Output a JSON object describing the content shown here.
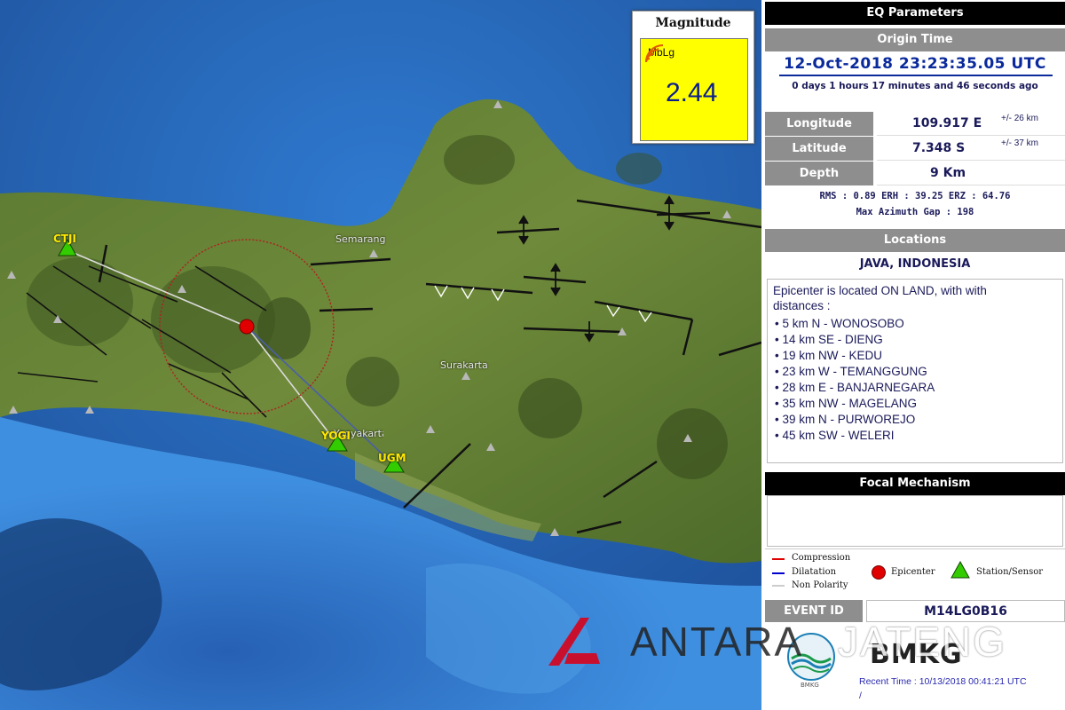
{
  "map": {
    "places": [
      "Semarang",
      "Surakarta",
      "Yogyakarta"
    ],
    "stations": [
      "CTJI",
      "YOGI",
      "UGM"
    ]
  },
  "magnitude": {
    "title": "Magnitude",
    "unit": "MbLg",
    "value": "2.44"
  },
  "eq": {
    "header": "EQ Parameters",
    "origin_header": "Origin Time",
    "origin_time": "12-Oct-2018 23:23:35.05 UTC",
    "elapsed": "0 days 1 hours 17 minutes and 46 seconds  ago",
    "params": [
      {
        "label": "Longitude",
        "value": "109.917 E",
        "err": "+/- 26 km"
      },
      {
        "label": "Latitude",
        "value": "7.348 S",
        "err": "+/- 37 km"
      },
      {
        "label": "Depth",
        "value": "9 Km",
        "err": ""
      }
    ],
    "rms_line": "RMS : 0.89  ERH : 39.25  ERZ : 64.76",
    "max_azimuth": "Max Azimuth Gap : 198"
  },
  "locations": {
    "header": "Locations",
    "region": "JAVA, INDONESIA",
    "intro": "Epicenter is located ON LAND, with with distances :",
    "items": [
      "5 km N - WONOSOBO",
      "14 km SE - DIENG",
      "19 km NW - KEDU",
      "23 km W - TEMANGGUNG",
      "28 km E - BANJARNEGARA",
      "35 km NW - MAGELANG",
      "39 km N - PURWOREJO",
      "45 km SW - WELERI"
    ]
  },
  "focal": {
    "header": "Focal Mechanism",
    "legend": {
      "compression": "Compression",
      "dilatation": "Dilatation",
      "non_polarity": "Non Polarity",
      "epicenter": "Epicenter",
      "station": "Station/Sensor"
    }
  },
  "event": {
    "label": "EVENT ID",
    "id": "M14LG0B16"
  },
  "brand": {
    "agency": "BMKG",
    "agency_small": "BMKG",
    "recent_time": "Recent Time : 10/13/2018 00:41:21 UTC",
    "recent_tail": "/"
  },
  "watermark": {
    "left": "ANTARA",
    "right": "JATENG"
  },
  "colors": {
    "header_black": "#000000",
    "header_grey": "#8e8e8e",
    "text_blue": "#0a2a9c",
    "compression": "#e00000",
    "dilatation": "#0000cc",
    "epicenter": "#e00000",
    "station": "#33cc00",
    "magnitude_box": "#ffff00"
  }
}
